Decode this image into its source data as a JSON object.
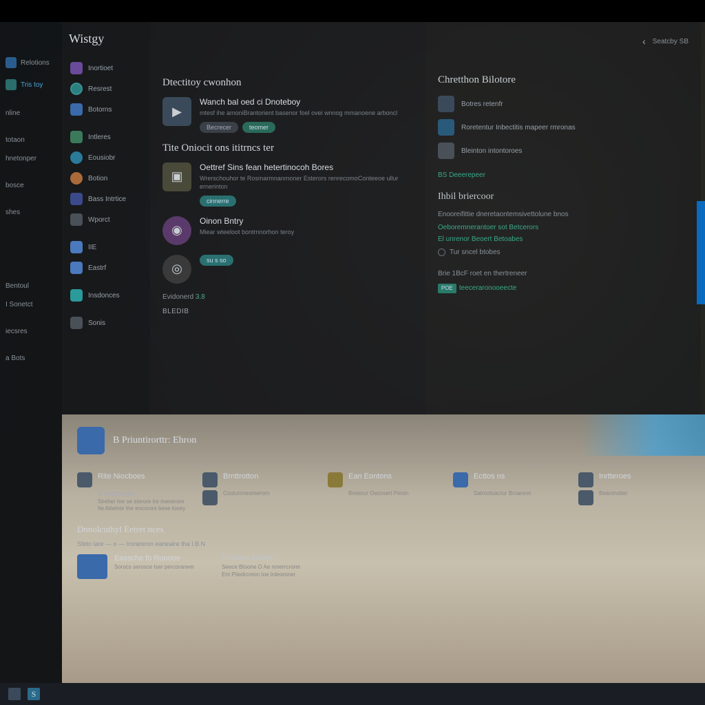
{
  "rail": {
    "items": [
      {
        "label": "Relotions",
        "iconClass": "blue"
      },
      {
        "label": "Tris toy",
        "iconClass": "teal",
        "active": true
      },
      {
        "label": "nline",
        "iconClass": ""
      },
      {
        "label": "totaon",
        "iconClass": ""
      },
      {
        "label": "hnetonper",
        "iconClass": ""
      },
      {
        "label": "bosce",
        "iconClass": ""
      },
      {
        "label": "shes",
        "iconClass": ""
      },
      {
        "label": "Bentoul",
        "iconClass": ""
      },
      {
        "label": "I Sonetct",
        "iconClass": ""
      },
      {
        "label": "iecsres",
        "iconClass": ""
      },
      {
        "label": "a Bots",
        "iconClass": ""
      }
    ]
  },
  "sidebar": {
    "title": "Wistgy",
    "items": [
      {
        "label": "Inortioet",
        "iconClass": "pur"
      },
      {
        "label": "Resrest",
        "iconClass": "tea"
      },
      {
        "label": "Botorns",
        "iconClass": "blu"
      },
      {
        "label": "Intleres",
        "iconClass": "gre"
      },
      {
        "label": "Eousiobr",
        "iconClass": "cya"
      },
      {
        "label": "Botion",
        "iconClass": "ora"
      },
      {
        "label": "Bass Intrtice",
        "iconClass": "dkb"
      },
      {
        "label": "Wporct",
        "iconClass": "gry"
      },
      {
        "label": "IIE",
        "iconClass": "lbl"
      },
      {
        "label": "Eastrf",
        "iconClass": "lbl"
      },
      {
        "label": "Insdonces",
        "iconClass": "tea2"
      },
      {
        "label": "Sonis",
        "iconClass": "gry"
      }
    ]
  },
  "main": {
    "section1": {
      "heading": "Dtectitoy cwonhon",
      "card": {
        "title": "Wanch bal oed ci Dnoteboy",
        "desc": "mtesf ihe amoniBrantorient basenor foel ovei wnnog mmanoene arboncl",
        "pill1": "Becrecer",
        "pill2": "teomer"
      }
    },
    "section2": {
      "heading": "Tite Oniocit ons ititrncs ter",
      "card1": {
        "title": "Oettref Sins fean hetertinocoh Bores",
        "desc": "Wrerschouhor te Rosmarmnanmoner Esterors renrecomoConteeoe ullur ernerinton",
        "pill": "cinnerre"
      },
      "card2": {
        "title": "Oinon Bntry",
        "desc": "Miear wteeloot bontrnnorhon teroy"
      },
      "card3": {
        "pill": "su s so"
      },
      "linkLabel": "Evidonerd",
      "linkValue": "3.8",
      "subHeading": "BLEDIB"
    }
  },
  "aside": {
    "backLabel": "‹",
    "miscLabel": "Seatcby SB",
    "heading": "Chretthon Bilotore",
    "rows": [
      {
        "label": "Botres retenfr"
      },
      {
        "label": "Roretentur Inbectitis mapeer rmronas"
      },
      {
        "label": "Bleinton intontoroes"
      }
    ],
    "link1": "BS Deeerepeer",
    "subHeading": "Ihbil briercoor",
    "texts": [
      "Enooreifittie dneretaontemsivettolune bnos",
      "Oeboremnerantoer sot Betcerors",
      "El unrenor Beoert Betoabes"
    ],
    "chkLabel": "Tur sncel btobes",
    "footer1": "Brie 1BcF roet en thertreneer",
    "badge": "POE",
    "footer2": "teeceraronooeecte"
  },
  "lower": {
    "headTitle": "B Priuntirorttr: Ehron",
    "tiles": [
      {
        "title": "Rite Niocboes",
        "sub": "S Sccbaneoe",
        "desc": "Sireher her se sterore tre menerore Ite Attetnor the encorore bese tooey",
        "iconClass": ""
      },
      {
        "title": "Brnttrotton",
        "sub": "",
        "desc": "Cooturoneomerorn",
        "iconClass": ""
      },
      {
        "title": "Ean Eontons",
        "sub": "",
        "desc": "Breterur Owcroert Peron",
        "iconClass": "y"
      },
      {
        "title": "Ecttos ns",
        "sub": "",
        "desc": "Satrootoacrur Broareon",
        "iconClass": "b"
      },
      {
        "title": "Inrtteroes",
        "sub": "",
        "desc": "Bearonstter",
        "iconClass": ""
      }
    ],
    "secHeading": "Dnnolcuthyl Eetret nces",
    "meta": "Sfeto lare — o — Irorareron eanealre tha I.B.N",
    "card": {
      "title": "Eassche fo Runooe",
      "desc": "Sorocs serosce tser percoraneer"
    },
    "col": {
      "title": "Roindron brabter",
      "line1": "Seece Btoone O Ae nmerrcrorer",
      "line2": "Ent Pitedrcreon toe lrdeoroner"
    }
  },
  "taskbar": {
    "s": "S"
  }
}
